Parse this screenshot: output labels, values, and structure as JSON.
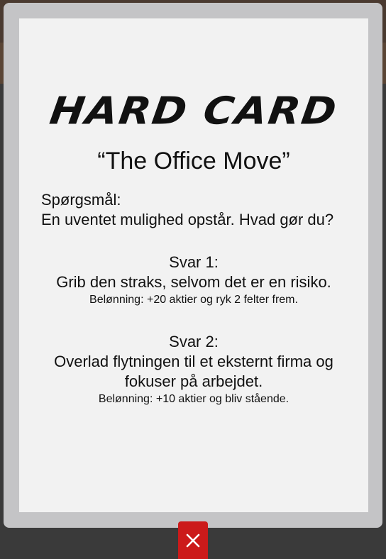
{
  "card": {
    "heading": "HARD CARD",
    "title": "“The Office Move”",
    "question_label": "Spørgsmål:",
    "question_text": "En uventet mulighed opstår. Hvad gør du?",
    "answers": [
      {
        "label": "Svar 1:",
        "text": "Grib den straks, selvom det er en risiko.",
        "reward": "Belønning: +20 aktier og ryk 2 felter frem."
      },
      {
        "label": "Svar 2:",
        "text": "Overlad flytningen til et eksternt firma og fokuser på arbejdet.",
        "reward": "Belønning: +10 aktier og bliv stående."
      }
    ]
  },
  "close_button": {
    "icon": "close-icon",
    "color": "#cc1a1a"
  }
}
